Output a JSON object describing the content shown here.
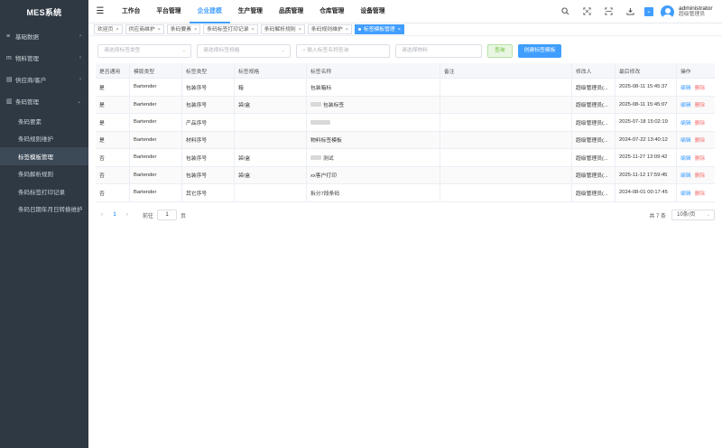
{
  "app": {
    "title": "MES系统"
  },
  "sidebar": {
    "groups": [
      {
        "label": "基础数据",
        "icon": "list-icon",
        "glyph": "≡",
        "chevron": "›"
      },
      {
        "label": "物料管理",
        "icon": "material-icon",
        "glyph": "m",
        "chevron": "›"
      },
      {
        "label": "供应商/客户",
        "icon": "supplier-icon",
        "glyph": "▤",
        "chevron": "›"
      },
      {
        "label": "条码管理",
        "icon": "barcode-icon",
        "glyph": "▥",
        "chevron": "⌄"
      }
    ],
    "subitems": [
      "条码要素",
      "条码规则维护",
      "标签模板管理",
      "条码解析规则",
      "条码标签打印记录",
      "条码日期年月日转换维护"
    ],
    "active_subitem": "标签模板管理"
  },
  "topnav": {
    "items": [
      "工作台",
      "平台管理",
      "企业建模",
      "生产管理",
      "品质管理",
      "仓库管理",
      "设备管理"
    ],
    "active": "企业建模"
  },
  "user": {
    "name": "administrator",
    "role": "超级管理员"
  },
  "tabs": [
    {
      "label": "欢迎页",
      "active": false
    },
    {
      "label": "供应商维护",
      "active": false
    },
    {
      "label": "条码要素",
      "active": false
    },
    {
      "label": "条码标签打印记录",
      "active": false
    },
    {
      "label": "条码解析规则",
      "active": false
    },
    {
      "label": "条码规则维护",
      "active": false
    },
    {
      "label": "标签模板管理",
      "active": true
    }
  ],
  "filters": {
    "type_placeholder": "请选择标签类型",
    "spec_placeholder": "请选择标签规格",
    "name_placeholder": "输入标签名称查询",
    "material_placeholder": "请选择物料",
    "query_label": "查询",
    "create_label": "创建标签模板"
  },
  "table": {
    "headers": [
      "是否通用",
      "模版类型",
      "标签类型",
      "标签规格",
      "标签名称",
      "备注",
      "修改人",
      "最后修改",
      "操作"
    ],
    "rows": [
      {
        "general": "是",
        "tpl_type": "Bartender",
        "label_type": "包装序号",
        "spec": "箱",
        "name": "包装箱标",
        "blur": false,
        "remark": "",
        "modifier": "超级管理员(...",
        "modified": "2025-08-11 15:45:37"
      },
      {
        "general": "是",
        "tpl_type": "Bartender",
        "label_type": "包装序号",
        "spec": "袋/盒",
        "name": "包装标签",
        "blur": true,
        "remark": "",
        "modifier": "超级管理员(...",
        "modified": "2025-08-11 15:45:07"
      },
      {
        "general": "是",
        "tpl_type": "Bartender",
        "label_type": "产品序号",
        "spec": "",
        "name": "",
        "blur": true,
        "remark": "",
        "modifier": "超级管理员(...",
        "modified": "2025-07-18 15:02:19"
      },
      {
        "general": "是",
        "tpl_type": "Bartender",
        "label_type": "材料序号",
        "spec": "",
        "name": "物料标签模板",
        "blur": false,
        "remark": "",
        "modifier": "超级管理员(...",
        "modified": "2024-07-22 13:40:12"
      },
      {
        "general": "否",
        "tpl_type": "Bartender",
        "label_type": "包装序号",
        "spec": "袋/盒",
        "name": "测试",
        "blur": true,
        "remark": "",
        "modifier": "超级管理员(...",
        "modified": "2025-11-27 13:09:42"
      },
      {
        "general": "否",
        "tpl_type": "Bartender",
        "label_type": "包装序号",
        "spec": "袋/盒",
        "name": "xx客户打印",
        "blur": false,
        "remark": "",
        "modifier": "超级管理员(...",
        "modified": "2025-11-12 17:59:45"
      },
      {
        "general": "否",
        "tpl_type": "Bartender",
        "label_type": "其它序号",
        "spec": "",
        "name": "拆分7段条码",
        "blur": false,
        "remark": "",
        "modifier": "超级管理员(...",
        "modified": "2024-08-01 00:17:45"
      }
    ],
    "edit_label": "编辑",
    "delete_label": "删除"
  },
  "pagination": {
    "prev": "‹",
    "next": "›",
    "current": "1",
    "goto_prefix": "前往",
    "goto_value": "1",
    "goto_suffix": "页",
    "total": "共 7 条",
    "page_size": "10条/页"
  },
  "colors": {
    "primary": "#409eff",
    "sidebar_bg": "#2e3944",
    "danger": "#f56c6c",
    "success": "#67c23a"
  }
}
